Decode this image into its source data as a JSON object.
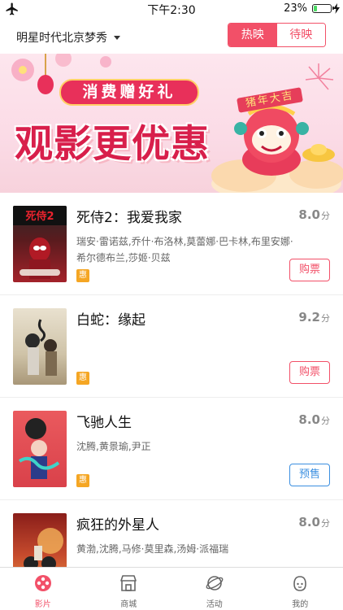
{
  "status_bar": {
    "time": "下午2:30",
    "battery_text": "23%",
    "battery_level": 0.23
  },
  "header": {
    "cinema_name": "明星时代北京梦秀",
    "tabs": [
      {
        "label": "热映",
        "active": true
      },
      {
        "label": "待映",
        "active": false
      }
    ]
  },
  "banner": {
    "ribbon_text": "消费赠好礼",
    "headline": "观影更优惠",
    "badge_text": "猪年大吉"
  },
  "movies": [
    {
      "title": "死侍2：我爱我家",
      "score": "8.0",
      "score_unit": "分",
      "cast": "瑞安·雷诺兹,乔什·布洛林,莫蕾娜·巴卡林,布里安娜·希尔德布兰,莎姬·贝兹",
      "tag": "惠",
      "button": "购票",
      "button_type": "buy",
      "poster_color": "#a3222a",
      "poster_text": "死侍2"
    },
    {
      "title": "白蛇：缘起",
      "score": "9.2",
      "score_unit": "分",
      "cast": "",
      "tag": "惠",
      "button": "购票",
      "button_type": "buy",
      "poster_color": "#cfc3a8",
      "poster_text": ""
    },
    {
      "title": "飞驰人生",
      "score": "8.0",
      "score_unit": "分",
      "cast": "沈腾,黄景瑜,尹正",
      "tag": "惠",
      "button": "预售",
      "button_type": "pre",
      "poster_color": "#d9414a",
      "poster_text": ""
    },
    {
      "title": "疯狂的外星人",
      "score": "8.0",
      "score_unit": "分",
      "cast": "黄渤,沈腾,马修·莫里森,汤姆·派福瑞",
      "tag": "",
      "button": "",
      "button_type": "pre",
      "poster_color": "#c64b2d",
      "poster_text": ""
    }
  ],
  "tabbar": [
    {
      "label": "影片",
      "icon": "film-reel-icon",
      "active": true
    },
    {
      "label": "商城",
      "icon": "store-icon",
      "active": false
    },
    {
      "label": "活动",
      "icon": "activity-planet-icon",
      "active": false
    },
    {
      "label": "我的",
      "icon": "profile-face-icon",
      "active": false
    }
  ],
  "colors": {
    "accent": "#f25068",
    "presale": "#3b8fe0",
    "tag": "#f5a623"
  }
}
